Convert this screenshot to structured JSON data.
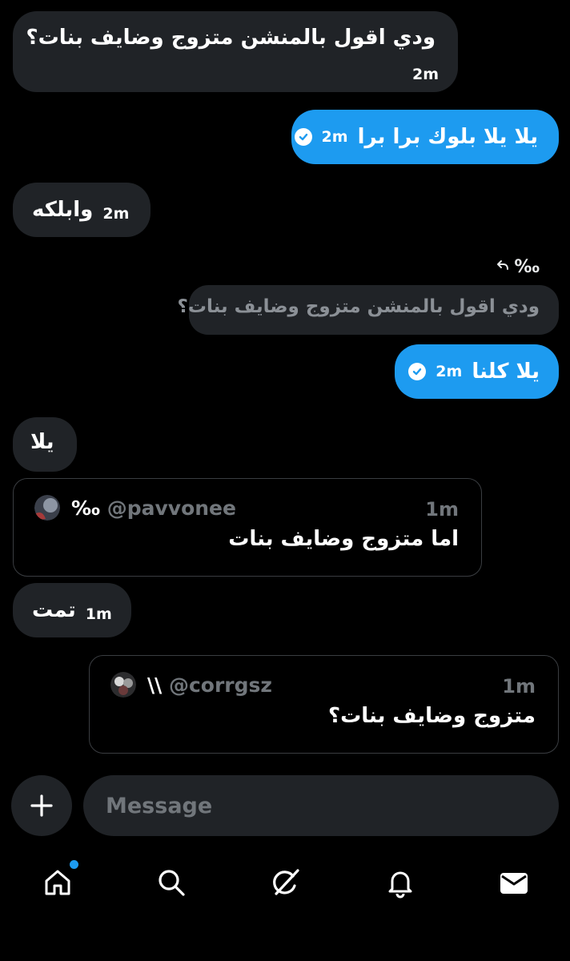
{
  "messages": [
    {
      "text": "ودي اقول بالمنشن متزوج وضايف بنات؟",
      "time": "2m"
    },
    {
      "text": "يلا يلا بلوك برا برا",
      "time": "2m"
    },
    {
      "text": "وابلكه",
      "time": "2m"
    },
    {
      "text": "يلا كلنا",
      "time": "2m"
    },
    {
      "text": "يلا"
    },
    {
      "text": "تمت",
      "time": "1m"
    }
  ],
  "reply": {
    "label": "‰",
    "quoted": "ودي اقول بالمنشن متزوج وضايف بنات؟"
  },
  "shared_posts": [
    {
      "display_name": "‰",
      "handle": "@pavvonee",
      "time": "1m",
      "text": "اما متزوج وضايف بنات"
    },
    {
      "display_name": "\\\\",
      "handle": "@corrgsz",
      "time": "1m",
      "text": "متزوج وضايف بنات؟"
    }
  ],
  "composer": {
    "placeholder": "Message"
  },
  "nav": [
    {
      "icon": "home-icon",
      "has_notification_dot": true
    },
    {
      "icon": "search-icon"
    },
    {
      "icon": "grok-icon"
    },
    {
      "icon": "bell-icon"
    },
    {
      "icon": "mail-icon"
    }
  ],
  "colors": {
    "background": "#000000",
    "received_bubble": "#202327",
    "sent_bubble": "#1d9bf0",
    "muted_text": "#71767b",
    "notification_dot": "#1d9bf0"
  }
}
